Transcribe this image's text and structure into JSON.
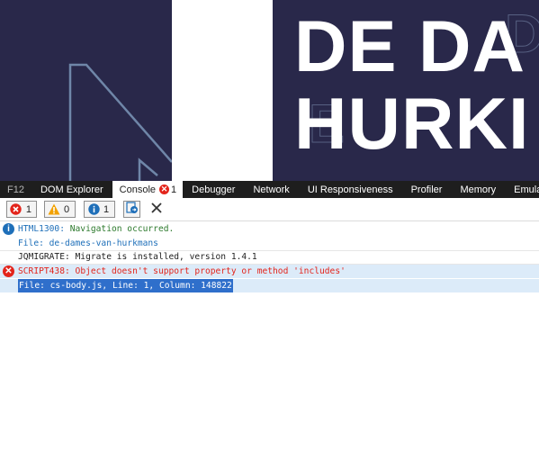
{
  "page": {
    "hero_line1": "DE DA",
    "hero_line2": "HURKI",
    "colors": {
      "navy": "#29284a",
      "white": "#ffffff"
    }
  },
  "devtools": {
    "tabs": [
      {
        "label": "F12",
        "id": "f12"
      },
      {
        "label": "DOM Explorer",
        "id": "dom-explorer"
      },
      {
        "label": "Console",
        "id": "console",
        "active": true,
        "error_count": "1"
      },
      {
        "label": "Debugger",
        "id": "debugger"
      },
      {
        "label": "Network",
        "id": "network"
      },
      {
        "label": "UI Responsiveness",
        "id": "ui-responsiveness"
      },
      {
        "label": "Profiler",
        "id": "profiler"
      },
      {
        "label": "Memory",
        "id": "memory"
      },
      {
        "label": "Emula",
        "id": "emulation"
      }
    ],
    "toolbar": {
      "errors": "1",
      "warnings": "0",
      "messages": "1",
      "icons": [
        "error-filter-icon",
        "warning-filter-icon",
        "info-filter-icon",
        "navigation-clear-icon",
        "clear-console-icon"
      ]
    },
    "console": {
      "messages": [
        {
          "type": "info",
          "code": "HTML1300:",
          "text": " Navigation occurred."
        },
        {
          "type": "file",
          "text": "File: de-dames-van-hurkmans"
        },
        {
          "type": "log",
          "text": "JQMIGRATE: Migrate is installed, version 1.4.1"
        },
        {
          "type": "error",
          "code": "SCRIPT438:",
          "text": " Object doesn't support property or method 'includes'"
        },
        {
          "type": "file",
          "text": "File: cs-body.js, Line: 1, Column: 148822",
          "selected": true
        }
      ]
    },
    "colors": {
      "tab_bar": "#1e1e1e",
      "error": "#e3241b",
      "info": "#1e6fb9",
      "warning": "#f2a100",
      "selection": "#2f6fcb"
    }
  }
}
